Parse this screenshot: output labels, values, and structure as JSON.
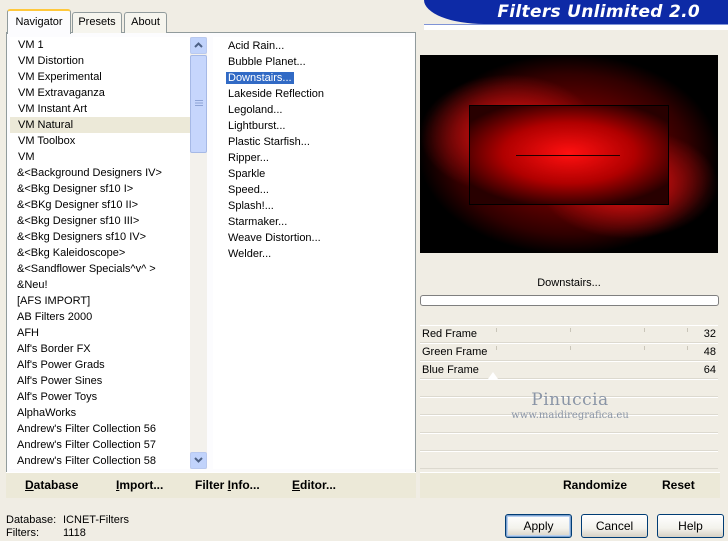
{
  "app": {
    "title": "Filters Unlimited 2.0"
  },
  "tabs": [
    {
      "label": "Navigator",
      "active": true
    },
    {
      "label": "Presets",
      "active": false
    },
    {
      "label": "About",
      "active": false
    }
  ],
  "categories": {
    "selected": "VM Natural",
    "items": [
      "VM 1",
      "VM Distortion",
      "VM Experimental",
      "VM Extravaganza",
      "VM Instant Art",
      "VM Natural",
      "VM Toolbox",
      "VM",
      "&<Background Designers IV>",
      "&<Bkg Designer sf10 I>",
      "&<BKg Designer sf10 II>",
      "&<Bkg Designer sf10 III>",
      "&<Bkg Designers sf10 IV>",
      "&<Bkg Kaleidoscope>",
      "&<Sandflower Specials^v^ >",
      "&Neu!",
      "[AFS IMPORT]",
      "AB Filters 2000",
      "AFH",
      "Alf's Border FX",
      "Alf's Power Grads",
      "Alf's Power Sines",
      "Alf's Power Toys",
      "AlphaWorks",
      "Andrew's Filter Collection 56",
      "Andrew's Filter Collection 57",
      "Andrew's Filter Collection 58"
    ]
  },
  "filters": {
    "selected": "Downstairs...",
    "items": [
      "Acid Rain...",
      "Bubble Planet...",
      "Downstairs...",
      "Lakeside Reflection",
      "Legoland...",
      "Lightburst...",
      "Plastic Starfish...",
      "Ripper...",
      "Sparkle",
      "Speed...",
      "Splash!...",
      "Starmaker...",
      "Weave Distortion...",
      "Welder..."
    ]
  },
  "left_buttons": {
    "database": {
      "ul": "D",
      "rest": "atabase"
    },
    "import": {
      "ul": "I",
      "rest": "mport..."
    },
    "filter_info": {
      "pre": "Filter ",
      "ul": "I",
      "rest": "nfo..."
    },
    "editor": {
      "ul": "E",
      "rest": "ditor..."
    }
  },
  "preview": {
    "filter_name": "Downstairs...",
    "progress": 0
  },
  "parameters": [
    {
      "label": "Red Frame",
      "value": "32"
    },
    {
      "label": "Green Frame",
      "value": "48"
    },
    {
      "label": "Blue Frame",
      "value": "64"
    }
  ],
  "watermark": {
    "name": "Pinuccia",
    "url": "www.maidiregrafica.eu"
  },
  "right_buttons": {
    "randomize": "Randomize",
    "reset": "Reset"
  },
  "status": {
    "database_label": "Database:",
    "database_value": "ICNET-Filters",
    "filters_label": "Filters:",
    "filters_value": "1118"
  },
  "dialog_buttons": {
    "apply": "Apply",
    "cancel": "Cancel",
    "help": "Help"
  },
  "colors": {
    "banner": "#0d2aa6",
    "selection": "#316ac5",
    "preview_red": "#ff1010"
  }
}
